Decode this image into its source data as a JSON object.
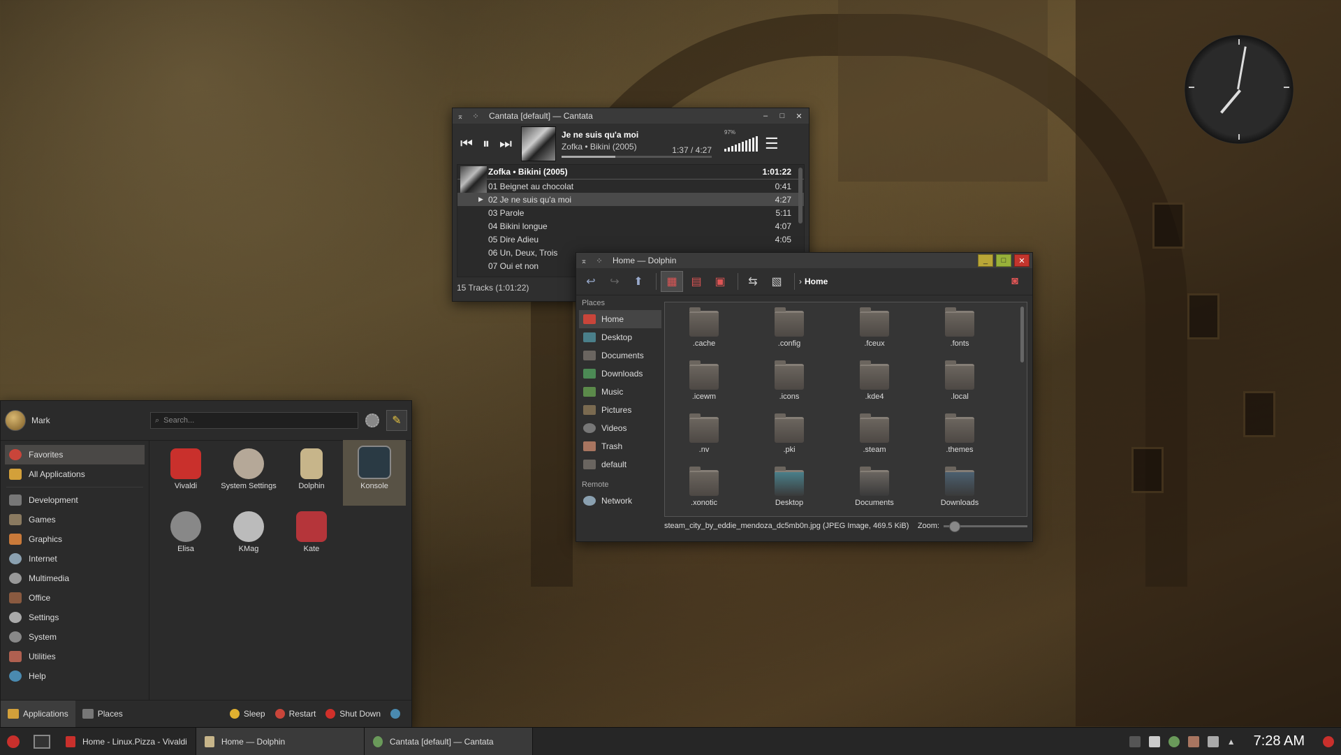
{
  "colors": {
    "accent": "#c3352d",
    "highlight": "#585245",
    "panel": "#2b2b2b"
  },
  "cantata": {
    "title": "Cantata [default] — Cantata",
    "now_title": "Je ne suis qu'a moi",
    "now_artist": "Zofka • Bikini (2005)",
    "time": "1:37 / 4:27",
    "progress": 0.36,
    "volume": "97%",
    "album": "Zofka • Bikini (2005)",
    "album_duration": "1:01:22",
    "tracks": [
      {
        "name": "01 Beignet au chocolat",
        "dur": "0:41"
      },
      {
        "name": "02 Je ne suis qu'a moi",
        "dur": "4:27"
      },
      {
        "name": "03 Parole",
        "dur": "5:11"
      },
      {
        "name": "04 Bikini longue",
        "dur": "4:07"
      },
      {
        "name": "05 Dire Adieu",
        "dur": "4:05"
      },
      {
        "name": "06 Un, Deux, Trois",
        "dur": ""
      },
      {
        "name": "07 Oui et non",
        "dur": ""
      }
    ],
    "status": "15 Tracks (1:01:22)"
  },
  "dolphin": {
    "title": "Home — Dolphin",
    "breadcrumb": "Home",
    "places_header": "Places",
    "places": [
      "Home",
      "Desktop",
      "Documents",
      "Downloads",
      "Music",
      "Pictures",
      "Videos",
      "Trash",
      "default"
    ],
    "remote_header": "Remote",
    "remote": [
      "Network"
    ],
    "files": [
      ".cache",
      ".config",
      ".fceux",
      ".fonts",
      ".icewm",
      ".icons",
      ".kde4",
      ".local",
      ".nv",
      ".pki",
      ".steam",
      ".themes",
      ".xonotic",
      "Desktop",
      "Documents",
      "Downloads"
    ],
    "status": "steam_city_by_eddie_mendoza_dc5mb0n.jpg (JPEG Image, 469.5 KiB)",
    "zoom_label": "Zoom:"
  },
  "launcher": {
    "user": "Mark",
    "search_placeholder": "Search...",
    "categories": [
      "Favorites",
      "All Applications",
      "Development",
      "Games",
      "Graphics",
      "Internet",
      "Multimedia",
      "Office",
      "Settings",
      "System",
      "Utilities",
      "Help"
    ],
    "apps": [
      "Vivaldi",
      "System Settings",
      "Dolphin",
      "Konsole",
      "Elisa",
      "KMag",
      "Kate"
    ],
    "footer": {
      "applications": "Applications",
      "places": "Places",
      "sleep": "Sleep",
      "restart": "Restart",
      "shutdown": "Shut Down"
    }
  },
  "taskbar": {
    "tasks": [
      "Home - Linux.Pizza - Vivaldi",
      "Home — Dolphin",
      "Cantata [default] — Cantata"
    ],
    "time": "7:28 AM"
  }
}
